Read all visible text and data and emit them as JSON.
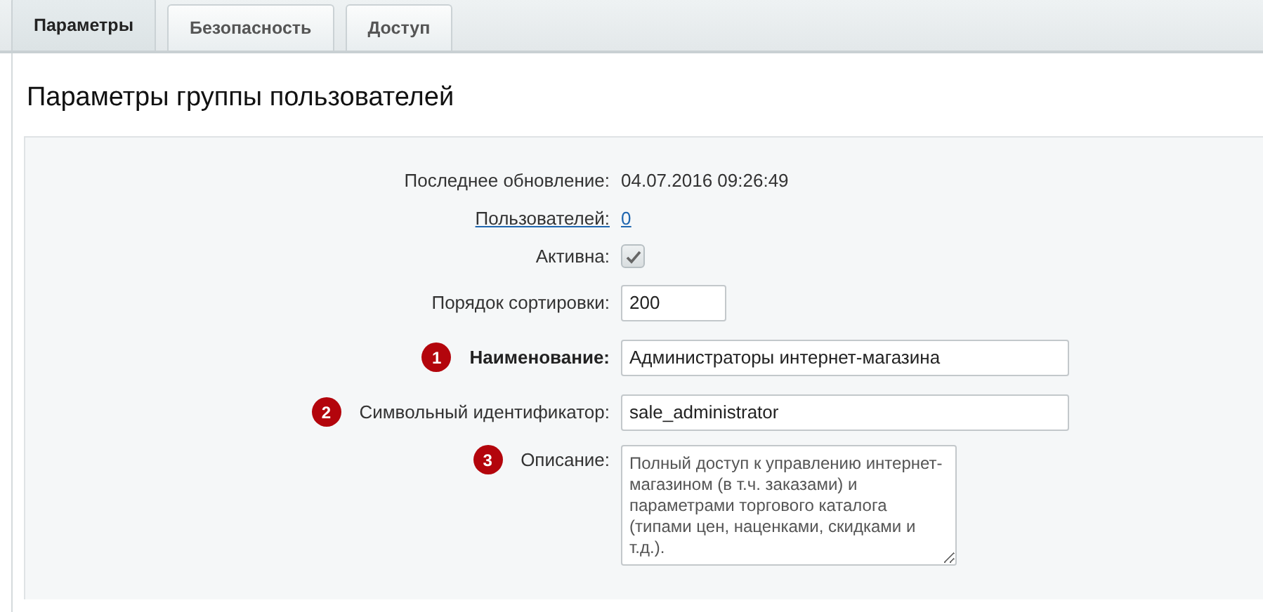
{
  "tabs": [
    {
      "label": "Параметры",
      "selected": true
    },
    {
      "label": "Безопасность",
      "selected": false
    },
    {
      "label": "Доступ",
      "selected": false
    }
  ],
  "panel": {
    "title": "Параметры группы пользователей"
  },
  "fields": [
    {
      "kind": "text",
      "label": "Последнее обновление:",
      "value": "04.07.2016 09:26:49"
    },
    {
      "kind": "link",
      "label": "Пользователей:",
      "value": "0"
    },
    {
      "kind": "checkbox",
      "label": "Активна:",
      "checked": true
    },
    {
      "kind": "number",
      "label": "Порядок сортировки:",
      "value": "200"
    },
    {
      "kind": "input",
      "label": "Наименование:",
      "value": "Администраторы интернет-магазина",
      "required": true,
      "marker": "1"
    },
    {
      "kind": "input",
      "label": "Символьный идентификатор:",
      "value": "sale_administrator",
      "required": false,
      "marker": "2"
    },
    {
      "kind": "textarea",
      "label": "Описание:",
      "value": "Полный доступ к управлению интернет-магазином (в т.ч. заказами) и параметрами торгового каталога (типами цен, наценками, скидками и т.д.).",
      "required": false,
      "marker": "3"
    }
  ]
}
